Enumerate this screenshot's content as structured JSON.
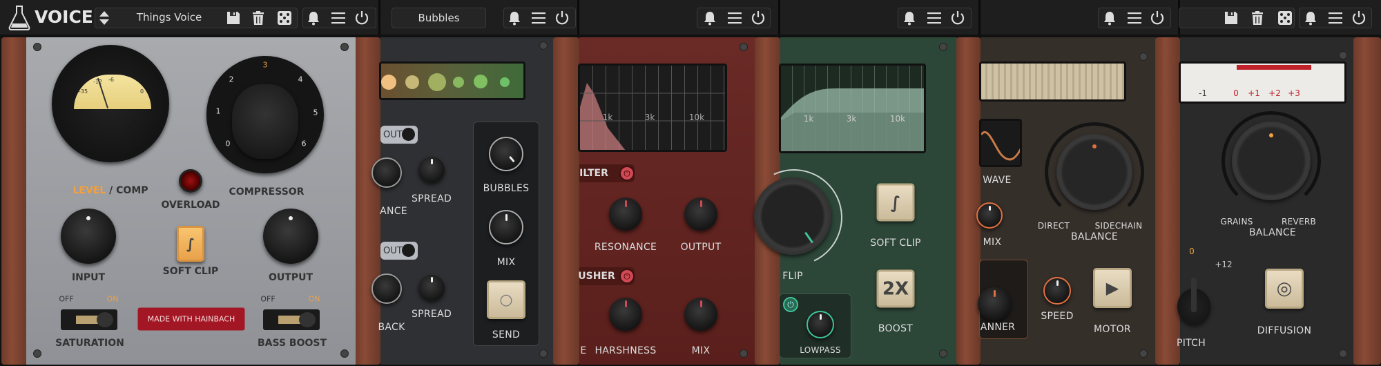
{
  "voice": {
    "title": "VOICE",
    "preset": "Things Voice",
    "meter_ticks": [
      "-35",
      "-12",
      "-6",
      "0"
    ],
    "dial_numbers": [
      "0",
      "1",
      "2",
      "3",
      "4",
      "5",
      "6"
    ],
    "level_label": "LEVEL",
    "comp_label": "/ COMP",
    "overload": "OVERLOAD",
    "compressor": "COMPRESSOR",
    "input": "INPUT",
    "soft_clip": "SOFT CLIP",
    "output": "OUTPUT",
    "off": "OFF",
    "on": "ON",
    "made_with": "MADE WITH HAINBACH",
    "saturation": "SATURATION",
    "bass_boost": "BASS BOOST",
    "accent": "#f0a040"
  },
  "bubbles": {
    "preset": "Bubbles",
    "out": "OUT",
    "spread": "SPREAD",
    "ance": "ANCE",
    "back": "BACK",
    "bubbles_label": "BUBBLES",
    "mix": "MIX",
    "send": "SEND"
  },
  "filter": {
    "freq_labels": [
      "1k",
      "3k",
      "10k"
    ],
    "filter_label": "ILTER",
    "resonance": "RESONANCE",
    "output": "OUTPUT",
    "crusher_label": "USHER",
    "e": "E",
    "harshness": "HARSHNESS",
    "mix": "MIX",
    "accent": "#d04a55"
  },
  "green": {
    "freq_labels": [
      "1k",
      "3k",
      "10k"
    ],
    "flip": "FLIP",
    "soft_clip": "SOFT CLIP",
    "boost_key": "2X",
    "boost": "BOOST",
    "lowpass": "LOWPASS",
    "accent": "#3fc49a"
  },
  "motor": {
    "wave": "WAVE",
    "mix": "MIX",
    "direct": "DIRECT",
    "sidechain": "SIDECHAIN",
    "balance": "BALANCE",
    "panner": "ANNER",
    "speed": "SPEED",
    "motor": "MOTOR",
    "accent": "#e07040"
  },
  "reverb": {
    "scale": [
      "-1",
      "0",
      "+1",
      "+2",
      "+3"
    ],
    "grains": "GRAINS",
    "reverb_label": "REVERB",
    "balance": "BALANCE",
    "pitch_zero": "0",
    "pitch_max": "+12",
    "pitch": "PITCH",
    "diffusion": "DIFFUSION"
  },
  "icons": [
    "flask-icon",
    "arrows-updown-icon",
    "save-icon",
    "trash-icon",
    "dice-icon",
    "bell-icon",
    "menu-icon",
    "power-icon"
  ]
}
